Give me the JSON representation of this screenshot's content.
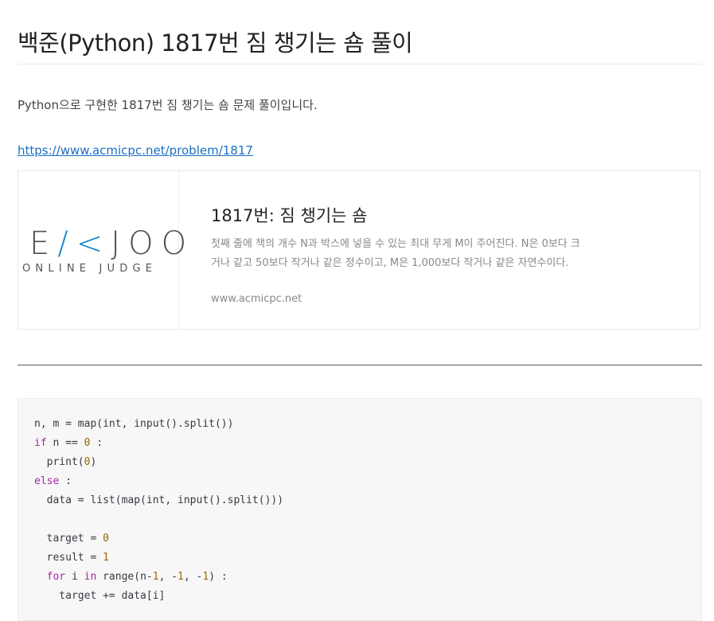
{
  "post": {
    "title": "백준(Python) 1817번 짐 챙기는 숌 풀이",
    "intro": "Python으로 구현한 1817번 짐 챙기는 숌 문제 풀이입니다.",
    "link": "https://www.acmicpc.net/problem/1817"
  },
  "card": {
    "logo_main_prefix": "E",
    "logo_main_accent": "/<",
    "logo_main_suffix": "JOO",
    "logo_sub": "ONLINE JUDGE",
    "title": "1817번: 짐 챙기는 숌",
    "description": "첫째 줄에 책의 개수 N과 박스에 넣을 수 있는 최대 무게 M이 주어진다. N은 0보다 크거나 같고 50보다 작거나 같은 정수이고, M은 1,000보다 작거나 같은 자연수이다.",
    "host": "www.acmicpc.net"
  },
  "code": {
    "l1": "n, m = map(int, input().split())",
    "l2_kw": "if",
    "l2_mid": " n == ",
    "l2_num": "0",
    "l2_end": " :",
    "l3_pre": "  print(",
    "l3_num": "0",
    "l3_end": ")",
    "l4_kw": "else",
    "l4_end": " :",
    "l5": "  data = list(map(int, input().split()))",
    "l7_pre": "  target = ",
    "l7_num": "0",
    "l8_pre": "  result = ",
    "l8_num": "1",
    "l9_kw1": "for",
    "l9_a": " i ",
    "l9_kw2": "in",
    "l9_b": " range(n-",
    "l9_n1": "1",
    "l9_c": ", -",
    "l9_n2": "1",
    "l9_d": ", -",
    "l9_n3": "1",
    "l9_e": ") :",
    "l10": "    target += data[i]"
  }
}
